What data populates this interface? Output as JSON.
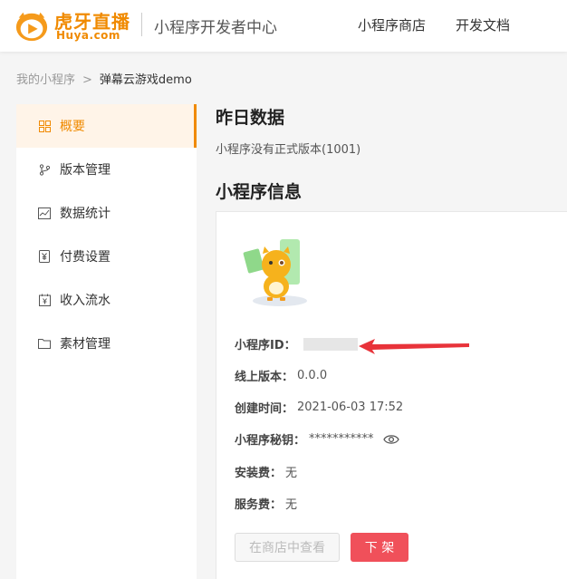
{
  "header": {
    "logo_main": "虎牙直播",
    "logo_sub": "Huya.com",
    "title": "小程序开发者中心",
    "nav": {
      "store": "小程序商店",
      "docs": "开发文档"
    }
  },
  "breadcrumb": {
    "root": "我的小程序",
    "sep": ">",
    "current": "弹幕云游戏demo"
  },
  "sidebar": {
    "items": [
      {
        "label": "概要",
        "icon": "grid-icon",
        "active": true
      },
      {
        "label": "版本管理",
        "icon": "branch-icon"
      },
      {
        "label": "数据统计",
        "icon": "chart-icon"
      },
      {
        "label": "付费设置",
        "icon": "yen-icon"
      },
      {
        "label": "收入流水",
        "icon": "calendar-yen-icon"
      },
      {
        "label": "素材管理",
        "icon": "folder-icon"
      }
    ]
  },
  "main": {
    "yesterday_title": "昨日数据",
    "no_release_text": "小程序没有正式版本(1001)",
    "info_title": "小程序信息",
    "fields": {
      "id_label": "小程序ID：",
      "version_label": "线上版本：",
      "version_value": "0.0.0",
      "created_label": "创建时间：",
      "created_value": "2021-06-03 17:52",
      "secret_label": "小程序秘钥：",
      "secret_value": "***********",
      "install_fee_label": "安装费：",
      "install_fee_value": "无",
      "service_fee_label": "服务费：",
      "service_fee_value": "无"
    },
    "buttons": {
      "view_in_store": "在商店中查看",
      "take_down": "下 架"
    }
  },
  "colors": {
    "accent": "#f08a00",
    "danger": "#f0505a",
    "annotation_arrow": "#e8333a"
  }
}
